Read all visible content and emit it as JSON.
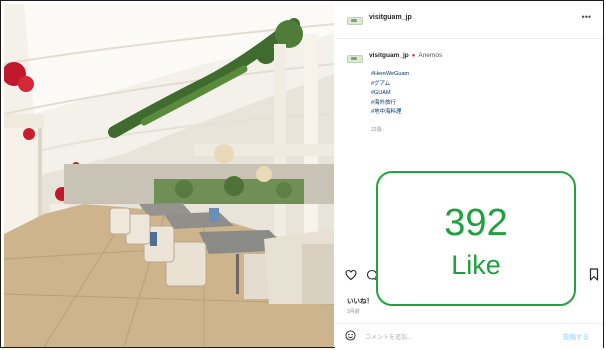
{
  "post": {
    "username": "visitguam_jp",
    "more_label": "•••",
    "caption": {
      "username": "visitguam_jp",
      "verified_dot": "●",
      "location": "Anemos",
      "hashtags": [
        "#HereWeGuam",
        "#グアム",
        "#GUAM",
        "#海外旅行",
        "#地中海料理"
      ],
      "age": "22週"
    },
    "likes_label": "いいね！",
    "date": "3月前",
    "comment_placeholder": "コメントを追加...",
    "post_button": "投稿する"
  },
  "overlay": {
    "count": "392",
    "label": "Like",
    "color": "#1fa03e"
  },
  "icons": {
    "heart": "heart-icon",
    "comment": "comment-icon",
    "save": "bookmark-icon",
    "emoji": "emoji-icon",
    "more": "more-icon"
  }
}
